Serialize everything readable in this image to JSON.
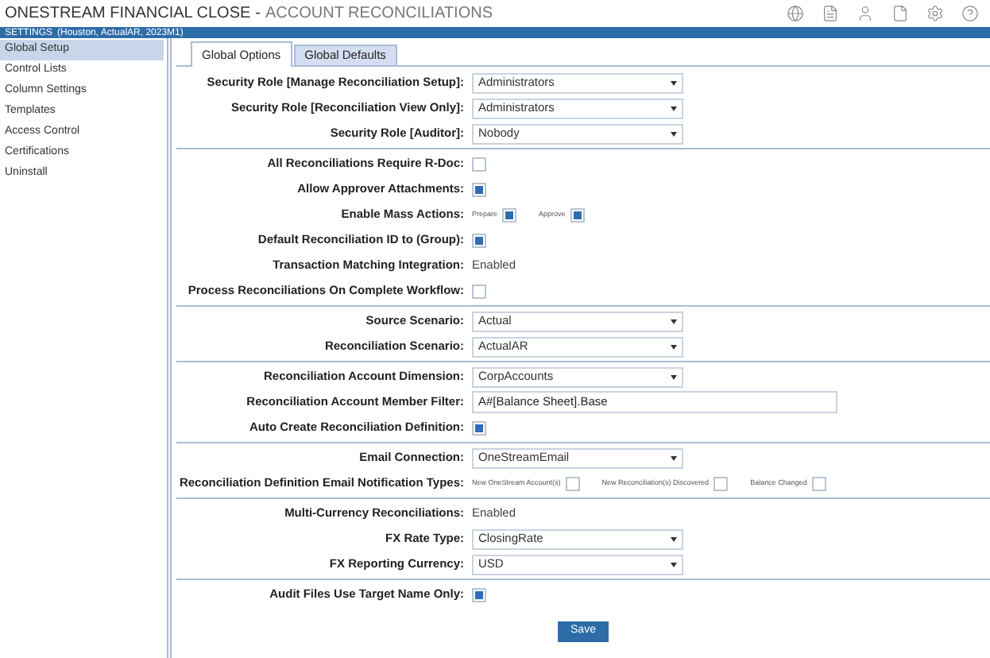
{
  "header": {
    "title": "ONESTREAM FINANCIAL CLOSE",
    "separator": "-",
    "subtitle": "ACCOUNT RECONCILIATIONS"
  },
  "settings_bar": {
    "title": "SETTINGS",
    "context": "(Houston, ActualAR, 2023M1)"
  },
  "sidebar": {
    "items": [
      {
        "label": "Global Setup",
        "selected": true
      },
      {
        "label": "Control Lists",
        "selected": false
      },
      {
        "label": "Column Settings",
        "selected": false
      },
      {
        "label": "Templates",
        "selected": false
      },
      {
        "label": "Access Control",
        "selected": false
      },
      {
        "label": "Certifications",
        "selected": false
      },
      {
        "label": "Uninstall",
        "selected": false
      }
    ]
  },
  "tabs": [
    {
      "label": "Global Options",
      "selected": true
    },
    {
      "label": "Global Defaults",
      "selected": false
    }
  ],
  "sections": [
    {
      "rows": [
        {
          "kind": "select",
          "label": "Security Role [Manage Reconciliation Setup]:",
          "value": "Administrators"
        },
        {
          "kind": "select",
          "label": "Security Role [Reconciliation View Only]:",
          "value": "Administrators"
        },
        {
          "kind": "select",
          "label": "Security Role [Auditor]:",
          "value": "Nobody"
        }
      ]
    },
    {
      "rows": [
        {
          "kind": "checkbox",
          "label": "All Reconciliations Require R-Doc:",
          "checked": false
        },
        {
          "kind": "checkbox",
          "label": "Allow Approver Attachments:",
          "checked": true
        },
        {
          "kind": "checkgroup",
          "label": "Enable Mass Actions:",
          "options": [
            {
              "label": "Prepare",
              "checked": true
            },
            {
              "label": "Approve",
              "checked": true
            }
          ]
        },
        {
          "kind": "checkbox",
          "label": "Default Reconciliation ID to (Group):",
          "checked": true
        },
        {
          "kind": "text",
          "label": "Transaction Matching Integration:",
          "value": "Enabled"
        },
        {
          "kind": "checkbox",
          "label": "Process Reconciliations On Complete Workflow:",
          "checked": false
        }
      ]
    },
    {
      "rows": [
        {
          "kind": "select",
          "label": "Source Scenario:",
          "value": "Actual"
        },
        {
          "kind": "select",
          "label": "Reconciliation Scenario:",
          "value": "ActualAR"
        }
      ]
    },
    {
      "rows": [
        {
          "kind": "select",
          "label": "Reconciliation Account Dimension:",
          "value": "CorpAccounts"
        },
        {
          "kind": "input",
          "label": "Reconciliation Account Member Filter:",
          "value": "A#[Balance Sheet].Base"
        },
        {
          "kind": "checkbox",
          "label": "Auto Create Reconciliation Definition:",
          "checked": true
        }
      ]
    },
    {
      "rows": [
        {
          "kind": "select",
          "label": "Email Connection:",
          "value": "OneStreamEmail"
        },
        {
          "kind": "checkgroup",
          "label": "Reconciliation Definition Email Notification Types:",
          "options": [
            {
              "label": "New OneStream Account(s)",
              "checked": false
            },
            {
              "label": "New Reconciliation(s) Discovered",
              "checked": false
            },
            {
              "label": "Balance Changed",
              "checked": false
            }
          ]
        }
      ]
    },
    {
      "rows": [
        {
          "kind": "text",
          "label": "Multi-Currency Reconciliations:",
          "value": "Enabled"
        },
        {
          "kind": "select",
          "label": "FX Rate Type:",
          "value": "ClosingRate"
        },
        {
          "kind": "select",
          "label": "FX Reporting Currency:",
          "value": "USD"
        }
      ]
    },
    {
      "rows": [
        {
          "kind": "checkbox",
          "label": "Audit Files Use Target Name Only:",
          "checked": true
        }
      ]
    }
  ],
  "save_button": "Save"
}
